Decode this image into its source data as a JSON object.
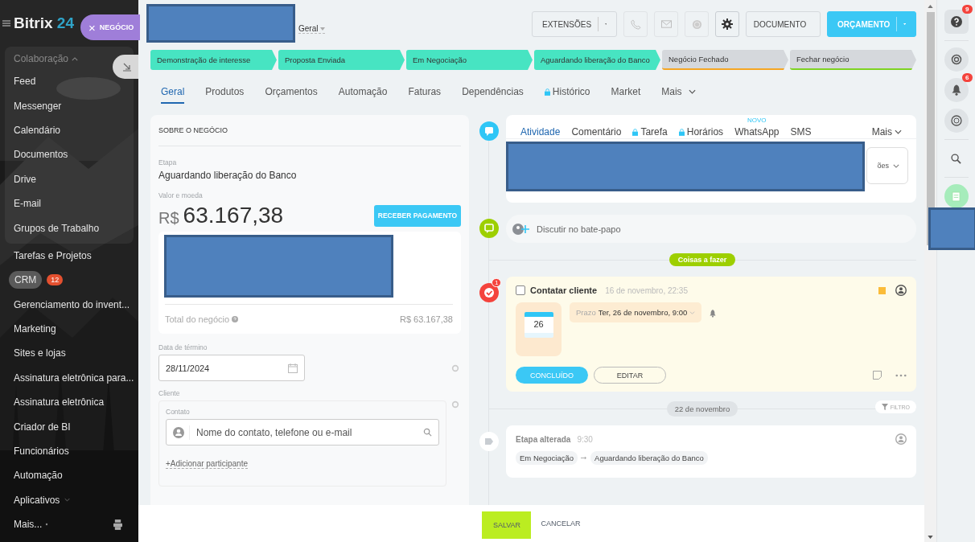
{
  "sidebar": {
    "logo": {
      "name": "Bitrix",
      "number": "24"
    },
    "entity_tab": {
      "close": "×",
      "label": "NEGÓCIO"
    },
    "group": {
      "label": "Colaboração",
      "expanded": true,
      "items": [
        "Feed",
        "Messenger",
        "Calendário",
        "Documentos",
        "Drive",
        "E-mail",
        "Grupos de Trabalho"
      ]
    },
    "items": [
      {
        "label": "Tarefas e Projetos",
        "kind": "plain",
        "selected": false
      },
      {
        "label": "CRM",
        "kind": "plain",
        "selected": true,
        "badge": "12"
      },
      {
        "label": "Gerenciamento do invent...",
        "kind": "plain",
        "selected": false
      },
      {
        "label": "Marketing",
        "kind": "plain",
        "selected": false
      },
      {
        "label": "Sites e lojas",
        "kind": "plain",
        "selected": false
      },
      {
        "label": "Assinatura eletrônica para...",
        "kind": "plain",
        "selected": false
      },
      {
        "label": "Assinatura eletrônica",
        "kind": "plain",
        "selected": false
      },
      {
        "label": "Criador de BI",
        "kind": "plain",
        "selected": false
      },
      {
        "label": "Funcionários",
        "kind": "plain",
        "selected": false
      },
      {
        "label": "Automação",
        "kind": "plain",
        "selected": false
      },
      {
        "label": "Aplicativos",
        "kind": "dropdown",
        "selected": false
      },
      {
        "label": "Mais...",
        "kind": "more",
        "selected": false
      }
    ]
  },
  "header": {
    "view_menu": "Geral",
    "extensions_button": "EXTENSÕES",
    "document_button": "DOCUMENTO",
    "primary_button": "ORÇAMENTO"
  },
  "stages": [
    {
      "label": "Demonstração de interesse",
      "reached": true,
      "color": "#47e4c2"
    },
    {
      "label": "Proposta Enviada",
      "reached": true,
      "color": "#47e4c2"
    },
    {
      "label": "Em Negociação",
      "reached": true,
      "color": "#47e4c2"
    },
    {
      "label": "Aguardando liberação do Banco",
      "reached": true,
      "color": "#47e4c2"
    },
    {
      "label": "Negócio Fechado",
      "reached": false,
      "color": "#f5a623"
    },
    {
      "label": "Fechar negócio",
      "reached": false,
      "color": "#7ed321"
    }
  ],
  "tabs": [
    {
      "label": "Geral",
      "selected": true,
      "locked": false,
      "dropdown": false
    },
    {
      "label": "Produtos",
      "selected": false,
      "locked": false,
      "dropdown": false
    },
    {
      "label": "Orçamentos",
      "selected": false,
      "locked": false,
      "dropdown": false
    },
    {
      "label": "Automação",
      "selected": false,
      "locked": false,
      "dropdown": false
    },
    {
      "label": "Faturas",
      "selected": false,
      "locked": false,
      "dropdown": false
    },
    {
      "label": "Dependências",
      "selected": false,
      "locked": false,
      "dropdown": false
    },
    {
      "label": "Histórico",
      "selected": false,
      "locked": true,
      "dropdown": false
    },
    {
      "label": "Market",
      "selected": false,
      "locked": false,
      "dropdown": false
    },
    {
      "label": "Mais",
      "selected": false,
      "locked": false,
      "dropdown": true
    }
  ],
  "deal_card": {
    "title": "SOBRE O NEGÓCIO",
    "stage_label": "Etapa",
    "stage_value": "Aguardando liberação do Banco",
    "amount_label": "Valor e moeda",
    "currency": "R$",
    "amount": "63.167,38",
    "pay_button": "RECEBER PAGAMENTO",
    "total_label": "Total do negócio",
    "total_value": "R$ 63.167,38",
    "end_date_label": "Data de término",
    "end_date": "28/11/2024",
    "client_label": "Cliente",
    "contact_label": "Contato",
    "contact_placeholder": "Nome do contato, telefone ou e-mail",
    "add_participant": "+Adicionar participante"
  },
  "timeline": {
    "composer_tabs": [
      {
        "label": "Atividade",
        "selected": true,
        "locked": false
      },
      {
        "label": "Comentário",
        "selected": false,
        "locked": false
      },
      {
        "label": "Tarefa",
        "selected": false,
        "locked": true
      },
      {
        "label": "Horários",
        "selected": false,
        "locked": true
      },
      {
        "label": "WhatsApp",
        "selected": false,
        "locked": false,
        "badge": "NOVO"
      },
      {
        "label": "SMS",
        "selected": false,
        "locked": false
      }
    ],
    "composer_more": "Mais",
    "composer_partial": "ões",
    "chat_prompt": "Discutir no bate-papo",
    "todo_heading": "Coisas a fazer",
    "task": {
      "badge": "1",
      "checked": false,
      "title": "Contatar cliente",
      "created": "16 de novembro, 22:35",
      "day": "26",
      "deadline_label": "Prazo",
      "deadline": "Ter, 26 de novembro, 9:00",
      "done_button": "CONCLUÍDO",
      "edit_button": "EDITAR"
    },
    "date_divider": "22 de novembro",
    "filter_button": "FILTRO",
    "history": {
      "title": "Etapa alterada",
      "time": "9:30",
      "from": "Em Negociação",
      "to": "Aguardando liberação do Banco"
    }
  },
  "footer": {
    "save_button": "SALVAR",
    "cancel_button": "CANCELAR"
  },
  "right_bar": {
    "help_badge": "9",
    "notifications_badge": "6"
  }
}
